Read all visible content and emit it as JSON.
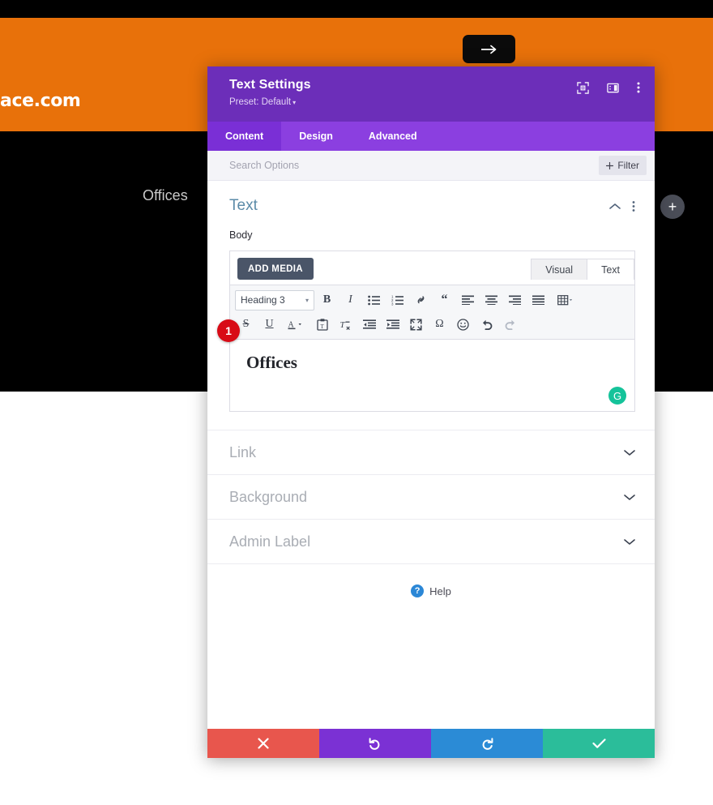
{
  "background": {
    "logo_text": "ace.com",
    "arrow_button_icon": "arrow-right-icon",
    "offices_text": "Offices",
    "add_module_icon": "plus-icon"
  },
  "modal": {
    "title": "Text Settings",
    "preset_label": "Preset: Default",
    "preset_caret": "▾",
    "header_icons": [
      {
        "name": "focus-target-icon"
      },
      {
        "name": "panel-layout-icon"
      },
      {
        "name": "more-vertical-icon"
      }
    ],
    "tabs": [
      {
        "label": "Content",
        "active": true
      },
      {
        "label": "Design",
        "active": false
      },
      {
        "label": "Advanced",
        "active": false
      }
    ],
    "search": {
      "placeholder": "Search Options",
      "value": ""
    },
    "filter_button": {
      "label": "Filter",
      "icon": "plus-icon"
    },
    "text_section": {
      "title": "Text",
      "collapse_icon": "chevron-up-icon",
      "menu_icon": "more-vertical-icon",
      "field_label": "Body",
      "add_media_label": "ADD MEDIA",
      "modes": [
        {
          "label": "Visual",
          "active": true
        },
        {
          "label": "Text",
          "active": false
        }
      ],
      "format_select": {
        "value": "Heading 3",
        "caret": "▾"
      },
      "toolbar_row1": [
        {
          "name": "bold-icon",
          "glyph": "B"
        },
        {
          "name": "italic-icon",
          "glyph": "I"
        },
        {
          "name": "bulleted-list-icon",
          "glyph": ""
        },
        {
          "name": "numbered-list-icon",
          "glyph": ""
        },
        {
          "name": "link-icon",
          "glyph": ""
        },
        {
          "name": "blockquote-icon",
          "glyph": "“"
        },
        {
          "name": "align-left-icon",
          "glyph": ""
        },
        {
          "name": "align-center-icon",
          "glyph": ""
        },
        {
          "name": "align-right-icon",
          "glyph": ""
        },
        {
          "name": "align-justify-icon",
          "glyph": ""
        },
        {
          "name": "table-icon",
          "glyph": ""
        }
      ],
      "toolbar_row2": [
        {
          "name": "strikethrough-icon",
          "glyph": "S"
        },
        {
          "name": "underline-icon",
          "glyph": "U"
        },
        {
          "name": "text-color-icon",
          "glyph": "A"
        },
        {
          "name": "paste-as-text-icon",
          "glyph": ""
        },
        {
          "name": "clear-formatting-icon",
          "glyph": ""
        },
        {
          "name": "outdent-icon",
          "glyph": ""
        },
        {
          "name": "indent-icon",
          "glyph": ""
        },
        {
          "name": "fullscreen-icon",
          "glyph": ""
        },
        {
          "name": "special-character-icon",
          "glyph": "Ω"
        },
        {
          "name": "emoji-icon",
          "glyph": "☺"
        },
        {
          "name": "undo-icon",
          "glyph": ""
        },
        {
          "name": "redo-icon",
          "glyph": ""
        }
      ],
      "content_heading": "Offices",
      "grammarly_glyph": "G",
      "step_badge": "1"
    },
    "closed_sections": [
      {
        "title": "Link",
        "icon": "chevron-down-icon"
      },
      {
        "title": "Background",
        "icon": "chevron-down-icon"
      },
      {
        "title": "Admin Label",
        "icon": "chevron-down-icon"
      }
    ],
    "help": {
      "label": "Help",
      "icon_glyph": "?"
    },
    "footer_buttons": [
      {
        "name": "cancel-button",
        "icon": "close-x-icon",
        "glyph": "✖",
        "color": "#e8564d"
      },
      {
        "name": "undo-button",
        "icon": "undo-arrow-icon",
        "glyph": "↺",
        "color": "#7b31d4"
      },
      {
        "name": "redo-button",
        "icon": "redo-arrow-icon",
        "glyph": "↻",
        "color": "#2b8bd6"
      },
      {
        "name": "save-button",
        "icon": "checkmark-icon",
        "glyph": "✔",
        "color": "#2bbd9a"
      }
    ]
  },
  "colors": {
    "brand_purple": "#6c2eb9",
    "tab_purple": "#8b3fe0",
    "accent_orange": "#e8710a",
    "save_teal": "#2bbd9a",
    "cancel_red": "#e8564d"
  }
}
